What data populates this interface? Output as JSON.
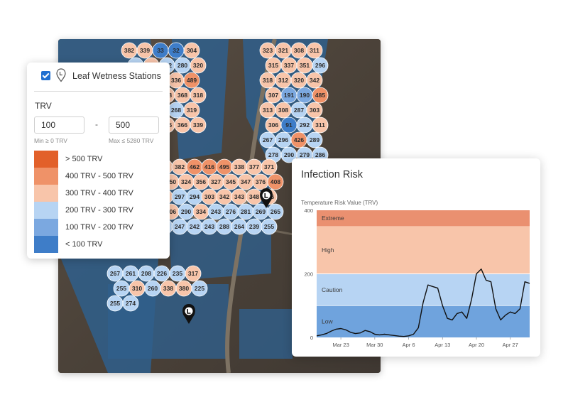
{
  "layer_panel": {
    "layer_name": "Leaf Wetness Stations",
    "layer_checked": true,
    "filter_label": "TRV",
    "min_value": "100",
    "max_value": "500",
    "min_hint": "Min ≥ 0 TRV",
    "max_hint": "Max ≤ 5280 TRV",
    "legend": [
      {
        "label": "> 500 TRV",
        "color": "#e2602a"
      },
      {
        "label": "400 TRV - 500 TRV",
        "color": "#ef9268"
      },
      {
        "label": "300 TRV - 400 TRV",
        "color": "#f8c5aa"
      },
      {
        "label": "200 TRV - 300 TRV",
        "color": "#b7d4f3"
      },
      {
        "label": "100 TRV - 200 TRV",
        "color": "#7ba8e0"
      },
      {
        "label": "< 100 TRV",
        "color": "#3e7dc8"
      }
    ]
  },
  "map": {
    "icons": [
      "leaf-wetness-station-marker-icon"
    ],
    "station_bubbles": [
      "382",
      "339",
      "33",
      "32",
      "304",
      "291",
      "305",
      "292",
      "280",
      "320",
      "305",
      "297",
      "323",
      "336",
      "489",
      "375",
      "390",
      "348",
      "368",
      "318",
      "363",
      "405",
      "415",
      "268",
      "319",
      "342",
      "329",
      "335",
      "366",
      "339",
      "323",
      "321",
      "308",
      "311",
      "315",
      "337",
      "351",
      "296",
      "318",
      "312",
      "320",
      "342",
      "307",
      "191",
      "190",
      "485",
      "313",
      "308",
      "287",
      "303",
      "306",
      "91",
      "292",
      "311",
      "267",
      "296",
      "426",
      "289",
      "278",
      "290",
      "279",
      "286",
      "312",
      "382",
      "462",
      "416",
      "495",
      "338",
      "377",
      "371",
      "350",
      "324",
      "356",
      "327",
      "345",
      "347",
      "376",
      "408",
      "320",
      "297",
      "294",
      "303",
      "342",
      "343",
      "348",
      "366",
      "306",
      "290",
      "334",
      "243",
      "276",
      "281",
      "269",
      "265",
      "228",
      "247",
      "242",
      "243",
      "288",
      "264",
      "239",
      "255",
      "267",
      "261",
      "208",
      "226",
      "235",
      "317",
      "255",
      "310",
      "260",
      "338",
      "380",
      "225",
      "255",
      "274"
    ]
  },
  "infection_risk": {
    "title": "Infection Risk",
    "subtitle": "Temperature Risk Value (TRV)"
  },
  "chart_data": {
    "type": "line",
    "title": "Infection Risk",
    "ylabel": "Temperature Risk Value (TRV)",
    "ylim": [
      0,
      400
    ],
    "yticks": [
      "400",
      "200",
      "0"
    ],
    "xticks": [
      "Mar 23",
      "Mar 30",
      "Apr 6",
      "Apr 13",
      "Apr 20",
      "Apr 27"
    ],
    "xrange": [
      "2024-03-18",
      "2024-05-01"
    ],
    "bands": [
      {
        "label": "Low",
        "from": 0,
        "to": 100,
        "color": "#6fa3dd"
      },
      {
        "label": "Caution",
        "from": 100,
        "to": 200,
        "color": "#b7d4f3"
      },
      {
        "label": "High",
        "from": 200,
        "to": 350,
        "color": "#f8c5aa"
      },
      {
        "label": "Extreme",
        "from": 350,
        "to": 400,
        "color": "#ea9070"
      }
    ],
    "series": [
      {
        "color": "#111111",
        "points": [
          [
            "2024-03-18",
            5
          ],
          [
            "2024-03-19",
            8
          ],
          [
            "2024-03-20",
            12
          ],
          [
            "2024-03-21",
            20
          ],
          [
            "2024-03-22",
            26
          ],
          [
            "2024-03-23",
            28
          ],
          [
            "2024-03-24",
            24
          ],
          [
            "2024-03-25",
            16
          ],
          [
            "2024-03-26",
            12
          ],
          [
            "2024-03-27",
            14
          ],
          [
            "2024-03-28",
            22
          ],
          [
            "2024-03-29",
            18
          ],
          [
            "2024-03-30",
            10
          ],
          [
            "2024-03-31",
            8
          ],
          [
            "2024-04-01",
            10
          ],
          [
            "2024-04-02",
            8
          ],
          [
            "2024-04-03",
            6
          ],
          [
            "2024-04-04",
            4
          ],
          [
            "2024-04-05",
            3
          ],
          [
            "2024-04-06",
            5
          ],
          [
            "2024-04-07",
            10
          ],
          [
            "2024-04-08",
            30
          ],
          [
            "2024-04-09",
            110
          ],
          [
            "2024-04-10",
            165
          ],
          [
            "2024-04-11",
            160
          ],
          [
            "2024-04-12",
            155
          ],
          [
            "2024-04-13",
            100
          ],
          [
            "2024-04-14",
            60
          ],
          [
            "2024-04-15",
            55
          ],
          [
            "2024-04-16",
            75
          ],
          [
            "2024-04-17",
            80
          ],
          [
            "2024-04-18",
            60
          ],
          [
            "2024-04-19",
            120
          ],
          [
            "2024-04-20",
            200
          ],
          [
            "2024-04-21",
            215
          ],
          [
            "2024-04-22",
            180
          ],
          [
            "2024-04-23",
            175
          ],
          [
            "2024-04-24",
            90
          ],
          [
            "2024-04-25",
            55
          ],
          [
            "2024-04-26",
            70
          ],
          [
            "2024-04-27",
            80
          ],
          [
            "2024-04-28",
            75
          ],
          [
            "2024-04-29",
            90
          ],
          [
            "2024-04-30",
            175
          ],
          [
            "2024-05-01",
            170
          ]
        ]
      }
    ]
  }
}
